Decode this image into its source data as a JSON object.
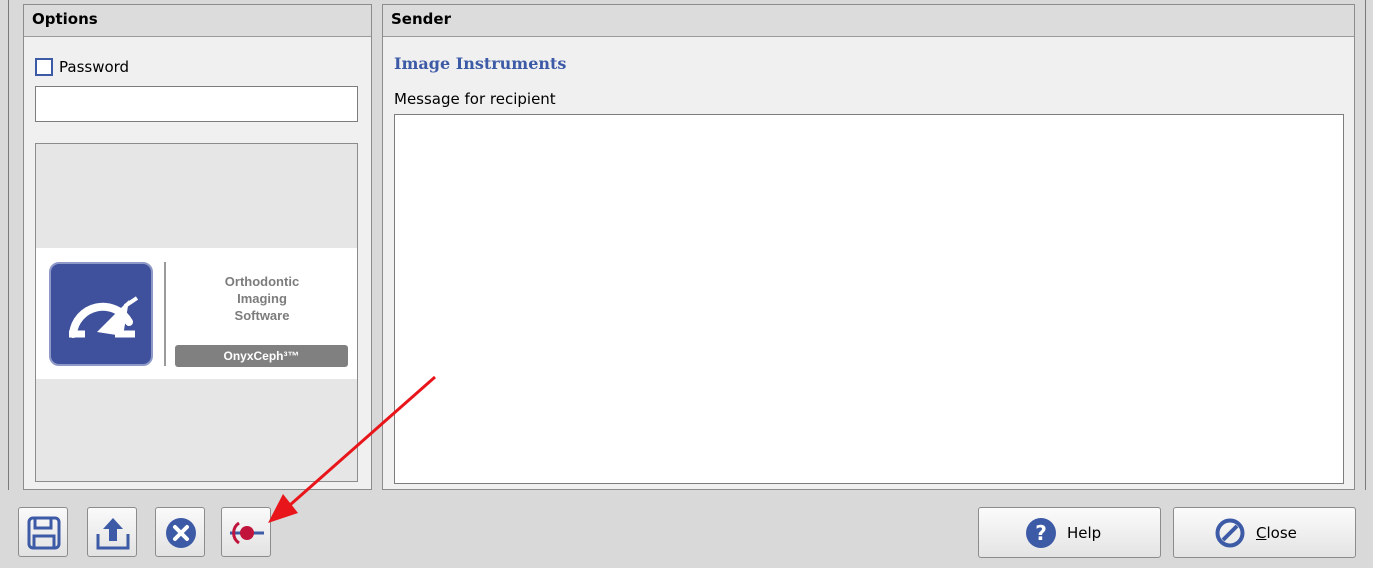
{
  "options": {
    "header": "Options",
    "password_label": "Password",
    "password_value": "",
    "password_checked": false,
    "logo": {
      "line1": "Orthodontic",
      "line2": "Imaging",
      "line3": "Software",
      "brand": "OnyxCeph³™"
    }
  },
  "sender": {
    "header": "Sender",
    "name": "Image Instruments",
    "message_label": "Message for recipient",
    "message_value": ""
  },
  "toolbar": {
    "icons": [
      "save-icon",
      "upload-icon",
      "cancel-circle-icon",
      "connect-target-icon"
    ]
  },
  "buttons": {
    "help_label": "Help",
    "close_accel": "C",
    "close_rest": "lose"
  },
  "colors": {
    "accent": "#3c5aa6",
    "arrow": "#e8161b"
  }
}
